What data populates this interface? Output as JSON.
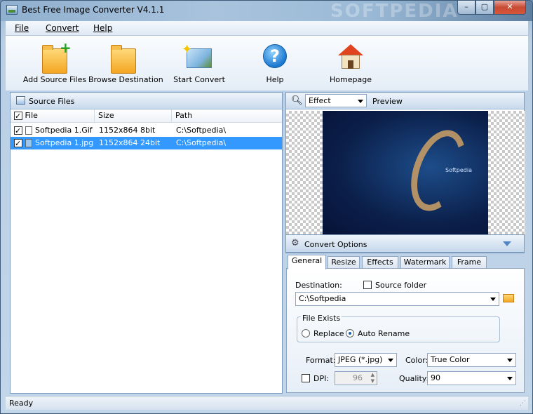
{
  "window": {
    "title": "Best Free Image Converter V4.1.1",
    "watermark": "SOFTPEDIA"
  },
  "menu": [
    {
      "label": "File"
    },
    {
      "label": "Convert"
    },
    {
      "label": "Help"
    }
  ],
  "toolbar": {
    "add_source_files": "Add Source Files",
    "browse_destination": "Browse Destination",
    "start_convert": "Start Convert",
    "help": "Help",
    "homepage": "Homepage",
    "help_glyph": "?"
  },
  "source_panel": {
    "title": "Source Files",
    "columns": [
      "File",
      "Size",
      "Path"
    ],
    "rows": [
      {
        "checked": true,
        "file": "Softpedia 1.Gif",
        "size": "1152x864  8bit",
        "path": "C:\\Softpedia\\",
        "selected": false
      },
      {
        "checked": true,
        "file": "Softpedia 1.jpg",
        "size": "1152x864  24bit",
        "path": "C:\\Softpedia\\",
        "selected": true
      }
    ]
  },
  "preview_panel": {
    "effect_value": "Effect",
    "preview_label": "Preview",
    "image_caption": "Softpedia"
  },
  "convert_options": {
    "title": "Convert Options",
    "tabs": [
      "General",
      "Resize",
      "Effects",
      "Watermark",
      "Frame"
    ],
    "active_tab": "General",
    "destination_label": "Destination:",
    "source_folder_label": "Source folder",
    "source_folder_checked": false,
    "destination_value": "C:\\Softpedia",
    "file_exists_label": "File Exists",
    "replace_label": "Replace",
    "auto_rename_label": "Auto Rename",
    "file_exists_selected": "Auto Rename",
    "format_label": "Format:",
    "format_value": "JPEG (*.jpg)",
    "color_label": "Color:",
    "color_value": "True Color",
    "dpi_label": "DPI:",
    "dpi_checked": false,
    "dpi_value": "96",
    "quality_label": "Quality:",
    "quality_value": "90"
  },
  "status": {
    "text": "Ready"
  },
  "colors": {
    "selection": "#3399ff",
    "accent": "#7c9bbd",
    "close_button": "#c74a32"
  }
}
